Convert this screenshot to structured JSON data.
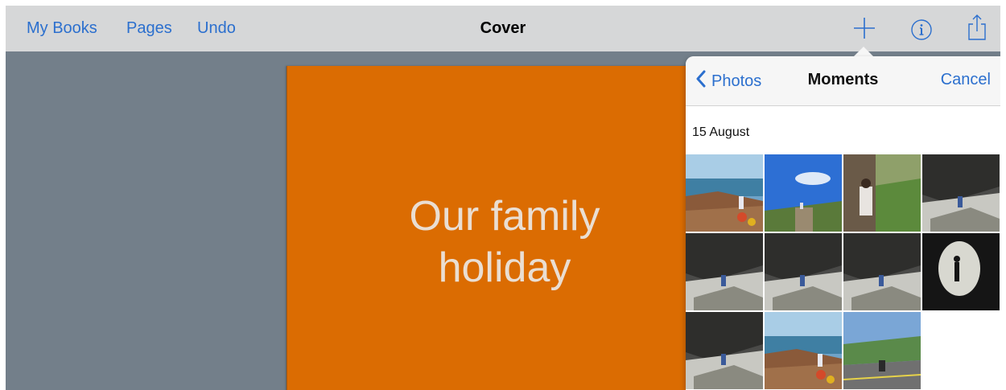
{
  "navbar": {
    "left_items": [
      "My Books",
      "Pages",
      "Undo"
    ],
    "title": "Cover",
    "icons": [
      "plus-icon",
      "info-icon",
      "share-icon"
    ]
  },
  "cover": {
    "title": "Our family\nholiday",
    "background_color": "#db6c02"
  },
  "popover": {
    "back_label": "Photos",
    "title": "Moments",
    "cancel_label": "Cancel",
    "section_date": "15 August",
    "photos": [
      {
        "name": "photo-coast-flowers",
        "scene": "coast"
      },
      {
        "name": "photo-steps-blue-sky",
        "scene": "sky"
      },
      {
        "name": "photo-child-on-grass",
        "scene": "grass"
      },
      {
        "name": "photo-cave-shore",
        "scene": "rock"
      },
      {
        "name": "photo-rocky-beach-1",
        "scene": "rock"
      },
      {
        "name": "photo-rocky-beach-2",
        "scene": "rock"
      },
      {
        "name": "photo-rock-seaweed",
        "scene": "rock"
      },
      {
        "name": "photo-cave-tunnel",
        "scene": "cave"
      },
      {
        "name": "photo-child-by-rock",
        "scene": "rock"
      },
      {
        "name": "photo-rocky-cove",
        "scene": "coast"
      },
      {
        "name": "photo-headland-road",
        "scene": "road"
      }
    ]
  },
  "colors": {
    "accent": "#2b6fce",
    "navbar": "#d6d7d8",
    "canvas": "#737f8a"
  }
}
